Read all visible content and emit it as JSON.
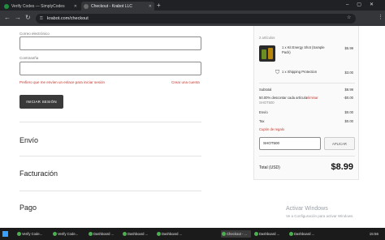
{
  "browser": {
    "tabs": [
      {
        "title": "Verify Codes — SimplyCodes",
        "active": false
      },
      {
        "title": "Checkout - Krabot LLC",
        "active": true
      }
    ],
    "url": "krabot.com/checkout"
  },
  "login": {
    "email_label": "Correo electrónico",
    "password_label": "Contraseña",
    "magic_link": "Prefiero que me envíen un enlace para iniciar sesión",
    "create_account": "Crear una cuenta",
    "login_button": "INICIAR SESIÓN"
  },
  "sections": {
    "shipping": "Envío",
    "billing": "Facturación",
    "payment": "Pago"
  },
  "summary": {
    "count": "2 artículos",
    "items": [
      {
        "qty_name": "1 x Kit Energy Shot (Sample Pack)",
        "price": "$5.99"
      },
      {
        "qty_name": "1 x Shipping Protection",
        "price": "$3.00"
      }
    ],
    "subtotal_label": "Subtotal",
    "subtotal": "$8.99",
    "discount_label": "50.00% descontar cada artículo",
    "discount_remove": "eliminar",
    "discount_code": "SHOT500",
    "discount": "-$0.00",
    "shipping_label": "Envío",
    "shipping": "$0.00",
    "tax_label": "Tax",
    "tax": "$0.00",
    "coupon_label": "Cupón de regalo",
    "coupon_value": "SHOT500",
    "apply_label": "APLICAR",
    "total_label": "Total (USD)",
    "total": "$8.99"
  },
  "watermark": {
    "title": "Activar Windows",
    "subtitle": "Ve a Configuración para activar Windows."
  },
  "taskbar": {
    "items": [
      "Verify Code...",
      "Verify Code...",
      "Dashboard ...",
      "Dashboard ...",
      "Dashboard ...",
      "Checkout - ...",
      "Dashboard ...",
      "Dashboard ..."
    ],
    "clock": "15:56"
  },
  "colors": {
    "accent_red": "#c0352b",
    "button_dark": "#3a3a3a"
  }
}
